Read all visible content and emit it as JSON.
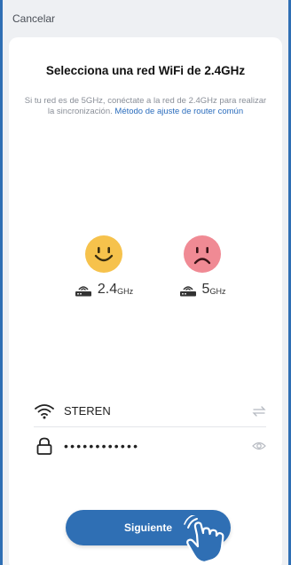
{
  "header": {
    "cancel_label": "Cancelar"
  },
  "main": {
    "title": "Selecciona una red WiFi de 2.4GHz",
    "info_text": "Si tu red es de 5GHz, conéctate a la red de 2.4GHz para realizar la sincronización. ",
    "info_link": "Método de ajuste de router común",
    "bands": [
      {
        "number": "2.4",
        "unit": "GHz",
        "icon": "smiley-face-icon",
        "color": "#f6c24c"
      },
      {
        "number": "5",
        "unit": "GHz",
        "icon": "sad-face-icon",
        "color": "#f08a94"
      }
    ]
  },
  "form": {
    "ssid": "STEREN",
    "password_masked": "••••••••••••"
  },
  "footer": {
    "next_label": "Siguiente"
  },
  "colors": {
    "accent": "#2f6fb4",
    "link": "#2b6dbd"
  }
}
